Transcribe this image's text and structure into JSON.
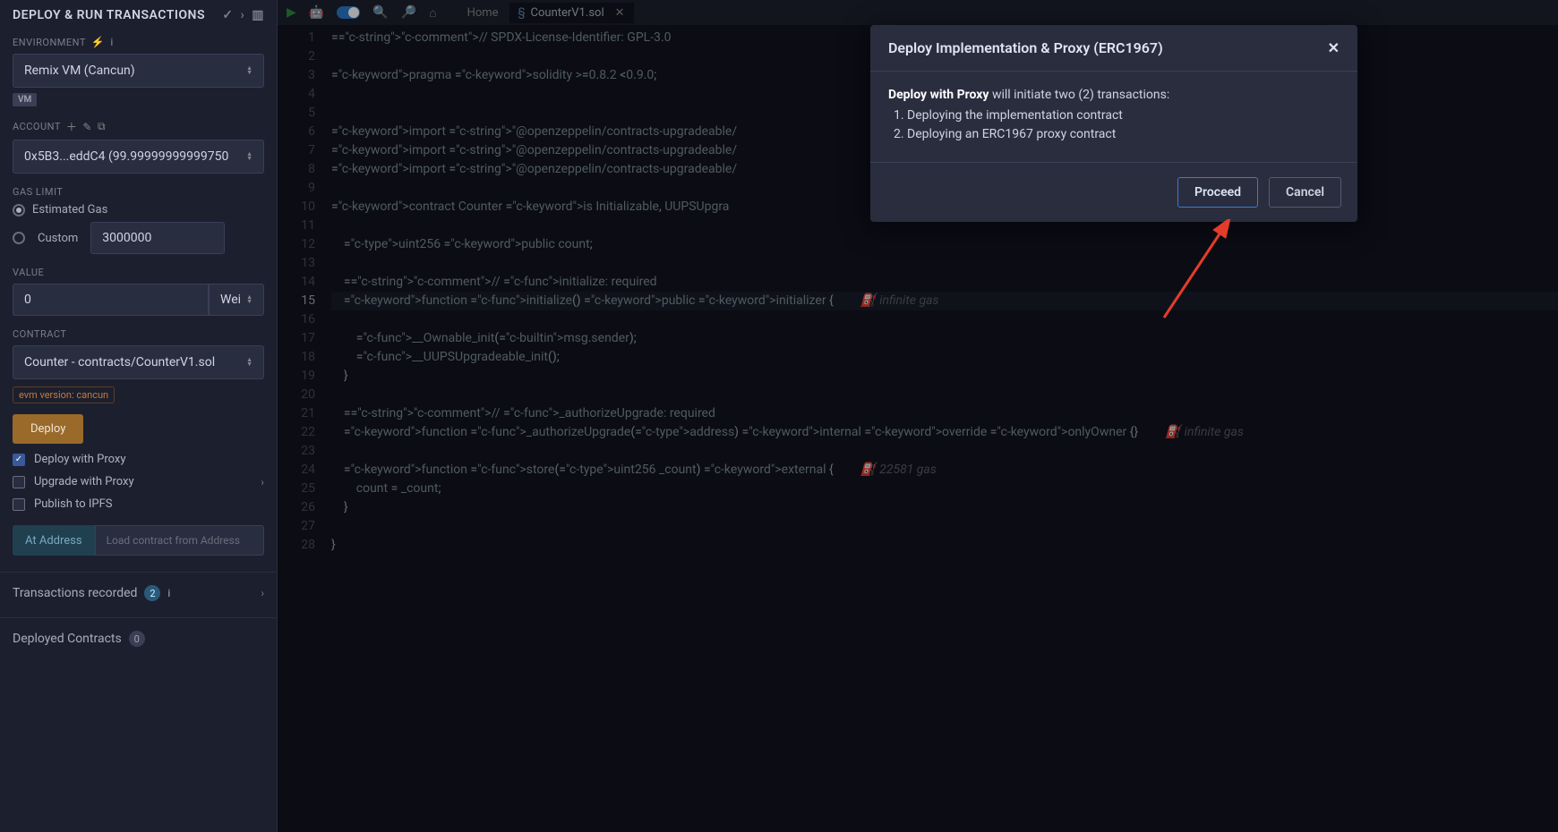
{
  "sidebar": {
    "title": "DEPLOY & RUN TRANSACTIONS",
    "environment_label": "ENVIRONMENT",
    "environment_value": "Remix VM (Cancun)",
    "vm_badge": "VM",
    "account_label": "ACCOUNT",
    "account_value": "0x5B3...eddC4 (99.99999999999750",
    "gas_limit_label": "GAS LIMIT",
    "gas_estimated": "Estimated Gas",
    "gas_custom_label": "Custom",
    "gas_custom_value": "3000000",
    "value_label": "VALUE",
    "value_amount": "0",
    "value_unit": "Wei",
    "contract_label": "CONTRACT",
    "contract_value": "Counter - contracts/CounterV1.sol",
    "evm_version_badge": "evm version: cancun",
    "deploy_btn": "Deploy",
    "checkboxes": {
      "deploy_proxy": "Deploy with Proxy",
      "upgrade_proxy": "Upgrade with Proxy",
      "publish_ipfs": "Publish to IPFS"
    },
    "at_address_btn": "At Address",
    "at_address_placeholder": "Load contract from Address",
    "transactions_recorded": {
      "label": "Transactions recorded",
      "count": "2"
    },
    "deployed_contracts": {
      "label": "Deployed Contracts",
      "count": "0"
    }
  },
  "toolbar": {
    "home_tab": "Home",
    "file_tab": "CounterV1.sol"
  },
  "editor": {
    "lines": [
      "// SPDX-License-Identifier: GPL-3.0",
      "",
      "pragma solidity >=0.8.2 <0.9.0;",
      "",
      "",
      "import \"@openzeppelin/contracts-upgradeable/",
      "import \"@openzeppelin/contracts-upgradeable/",
      "import \"@openzeppelin/contracts-upgradeable/",
      "",
      "contract Counter is Initializable, UUPSUpgra",
      "",
      "    uint256 public count;",
      "",
      "    // initialize: required",
      "    function initialize() public initializer {",
      "",
      "        __Ownable_init(msg.sender);",
      "        __UUPSUpgradeable_init();",
      "    }",
      "",
      "    // _authorizeUpgrade: required",
      "    function _authorizeUpgrade(address) internal override onlyOwner {}",
      "",
      "    function store(uint256 _count) external {",
      "        count = _count;",
      "    }",
      "",
      "}"
    ],
    "gas_hints": {
      "15": "infinite gas",
      "22": "infinite gas",
      "24": "22581 gas"
    },
    "current_line": 15
  },
  "modal": {
    "title": "Deploy Implementation & Proxy (ERC1967)",
    "intro_bold": "Deploy with Proxy",
    "intro_rest": " will initiate two (2) transactions:",
    "item1": "1. Deploying the implementation contract",
    "item2": "2. Deploying an ERC1967 proxy contract",
    "proceed": "Proceed",
    "cancel": "Cancel"
  }
}
